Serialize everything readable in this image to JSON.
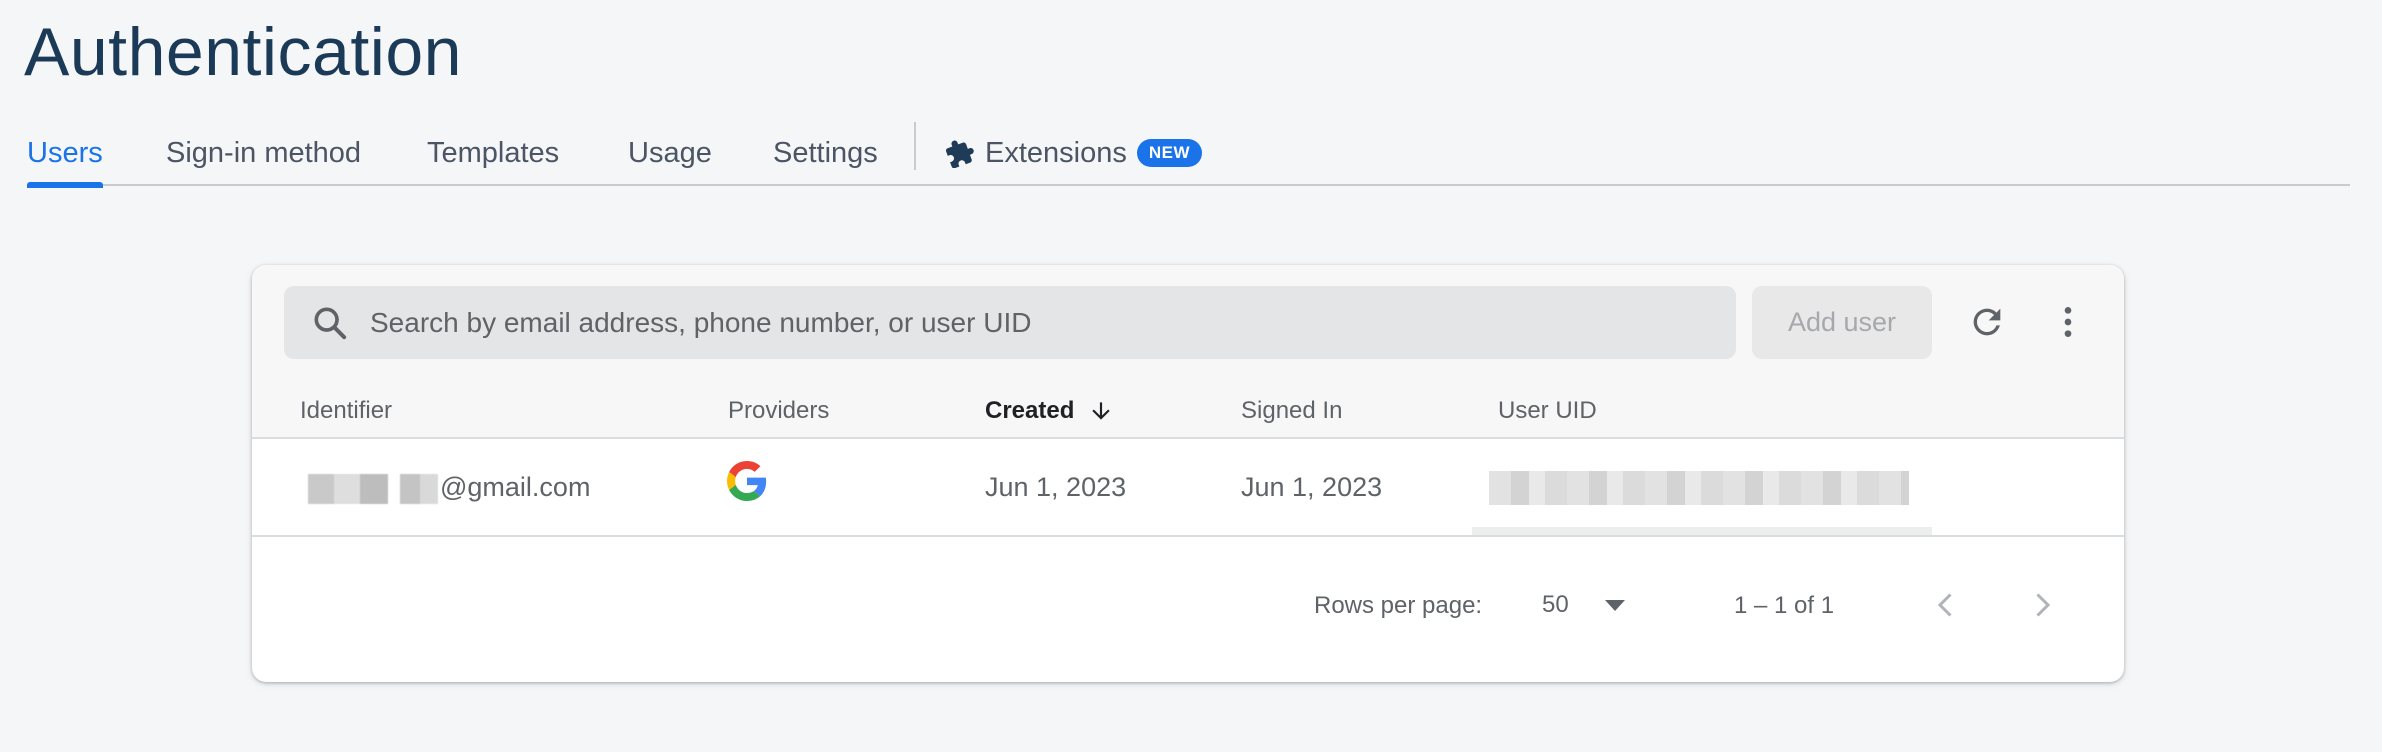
{
  "page": {
    "title": "Authentication"
  },
  "tabs": [
    {
      "label": "Users",
      "active": true
    },
    {
      "label": "Sign-in method"
    },
    {
      "label": "Templates"
    },
    {
      "label": "Usage"
    },
    {
      "label": "Settings"
    },
    {
      "label": "Extensions",
      "icon": "puzzle-piece-icon",
      "badge": "NEW"
    }
  ],
  "toolbar": {
    "search_placeholder": "Search by email address, phone number, or user UID",
    "add_user_label": "Add user",
    "refresh_icon": "refresh-icon",
    "more_icon": "more-vert-icon"
  },
  "table": {
    "columns": [
      "Identifier",
      "Providers",
      "Created",
      "Signed In",
      "User UID"
    ],
    "sorted_column": "Created",
    "sort_direction": "descending",
    "rows": [
      {
        "identifier_suffix": "@gmail.com",
        "provider_icon": "google-logo-icon",
        "created": "Jun 1, 2023",
        "signed_in": "Jun 1, 2023"
      }
    ]
  },
  "pagination": {
    "rows_per_page_label": "Rows per page:",
    "rows_per_page_value": "50",
    "range_text": "1 – 1 of 1"
  },
  "colors": {
    "accent": "#1a73e8",
    "title": "#1b3a57",
    "background": "#f5f6f8"
  }
}
